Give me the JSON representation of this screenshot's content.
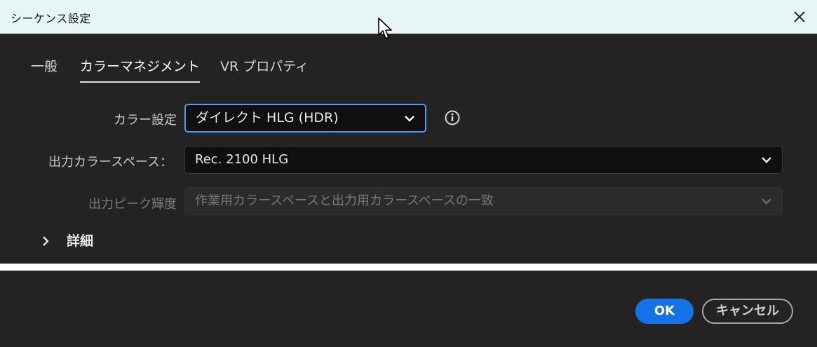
{
  "window": {
    "title": "シーケンス設定"
  },
  "tabs": [
    {
      "label": "一般",
      "active": false
    },
    {
      "label": "カラーマネジメント",
      "active": true
    },
    {
      "label": "VR プロパティ",
      "active": false
    }
  ],
  "form": {
    "color_setting": {
      "label": "カラー設定",
      "value": "ダイレクト HLG (HDR)"
    },
    "output_color_space": {
      "label": "出力カラースペース：",
      "value": "Rec. 2100 HLG"
    },
    "output_peak_luminance": {
      "label": "出力ピーク輝度",
      "value": "作業用カラースペースと出力用カラースペースの一致",
      "disabled": true
    }
  },
  "details": {
    "label": "詳細",
    "expanded": false
  },
  "buttons": {
    "ok_label": "OK",
    "cancel_label": "キャンセル"
  },
  "colors": {
    "panel_bg": "#232323",
    "titlebar_bg": "#e6f5f6",
    "accent": "#1473e6",
    "focus_ring": "#4b9cff"
  },
  "icons": {
    "close": "close-icon",
    "info": "info-icon",
    "chevron_down": "chevron-down-icon",
    "chevron_right": "chevron-right-icon",
    "cursor": "mouse-cursor-icon"
  }
}
